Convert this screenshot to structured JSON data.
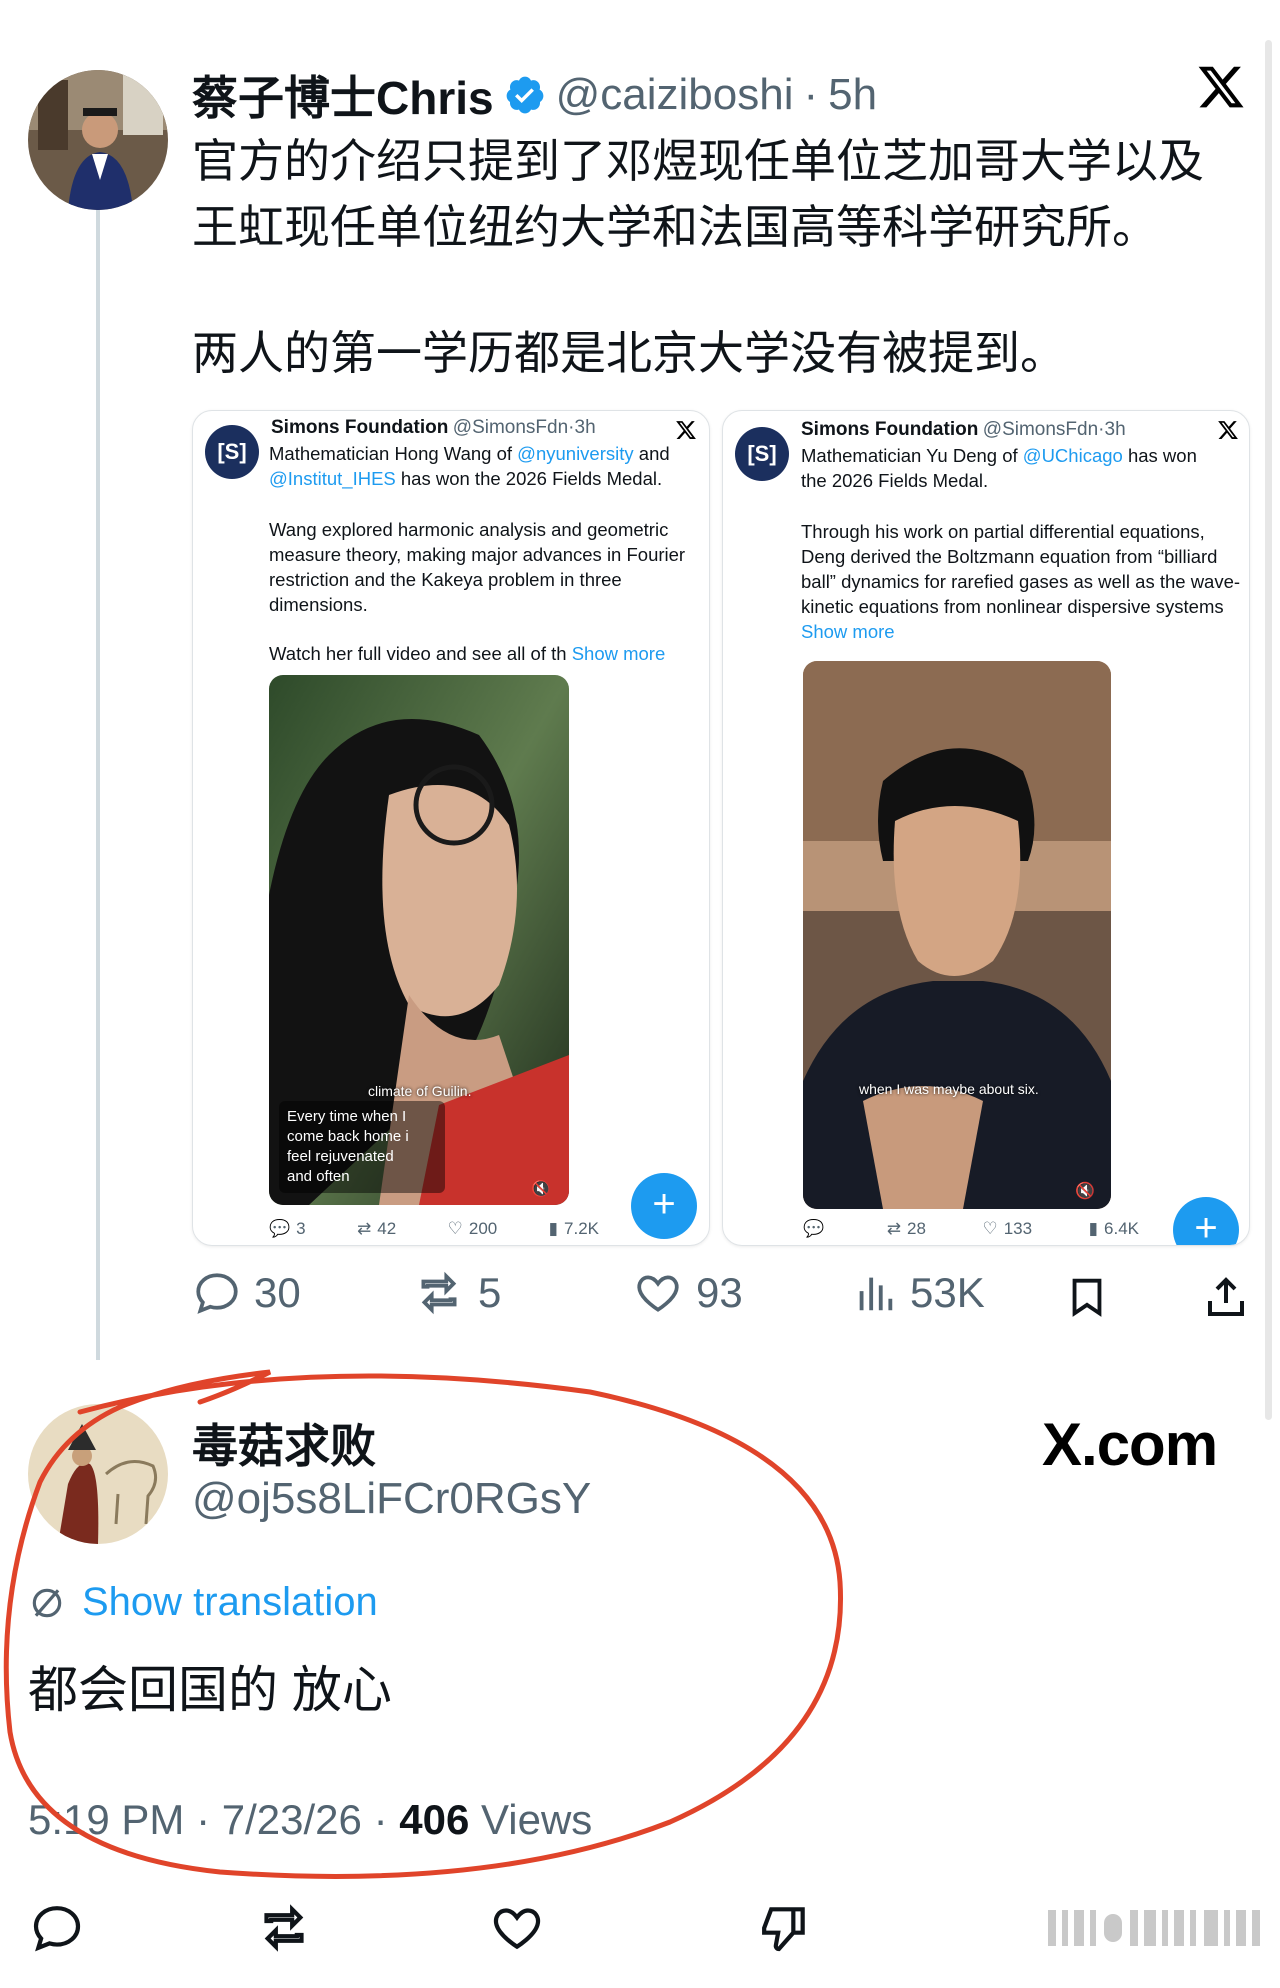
{
  "post": {
    "author_name": "蔡子博士Chris",
    "handle": "@caiziboshi",
    "separator": "·",
    "time": "5h",
    "text_line1": "官方的介绍只提到了邓煜现任单位芝加哥大学以及",
    "text_line2": "王虹现任单位纽约大学和法国高等科学研究所。",
    "text_line3": "两人的第一学历都是北京大学没有被提到。",
    "stats": {
      "replies": "30",
      "reposts": "5",
      "likes": "93",
      "views": "53K"
    }
  },
  "embedded_cards": [
    {
      "logo_text": "[S]",
      "name": "Simons Foundation",
      "handle": "@SimonsFdn",
      "separator": "·",
      "time": "3h",
      "text_a": "Mathematician Hong Wang of ",
      "link1": "@nyuniversity",
      "text_b": " and",
      "link2": "@Institut_IHES",
      "text_c": " has won the 2026 Fields Medal.",
      "para2": "Wang explored harmonic analysis and geometric measure theory, making major advances in Fourier restriction and the Kakeya problem in three dimensions.",
      "para3": "Watch her full video and see all of th ",
      "show_more": "Show more",
      "caption_top": "climate of Guilin.",
      "caption_lines": [
        "Every time when I",
        "come back home i",
        "feel rejuvenated",
        "and often"
      ],
      "stats": {
        "replies": "3",
        "reposts": "42",
        "likes": "200",
        "views": "7.2K"
      },
      "fab": "+"
    },
    {
      "logo_text": "[S]",
      "name": "Simons Foundation",
      "handle": "@SimonsFdn",
      "separator": "·",
      "time": "3h",
      "text_a": "Mathematician Yu Deng of ",
      "link1": "@UChicago",
      "text_b": " has won",
      "text_c": "the 2026 Fields Medal.",
      "para2": "Through his work on partial differential equations, Deng derived the Boltzmann equation from “billiard ball” dynamics for rarefied gases as well as the wave-kinetic equations from nonlinear dispersive systems ",
      "show_more": "Show more",
      "caption": "when I was maybe about six.",
      "stats": {
        "replies": "",
        "reposts": "28",
        "likes": "133",
        "views": "6.4K"
      },
      "fab": "+"
    }
  ],
  "reply": {
    "author_name": "毒菇求败",
    "handle": "@oj5s8LiFCr0RGsY",
    "brand": "X.com",
    "show_translation": "Show translation",
    "text": "都会回国的 放心",
    "time": "5:19 PM",
    "separator": "·",
    "date": "7/23/26",
    "separator2": "·",
    "views_count": "406",
    "views_label": "Views"
  },
  "colors": {
    "accent": "#1d9bf0",
    "verified": "#1d9bf0",
    "annotation": "#e0442a",
    "muted": "#536471"
  }
}
